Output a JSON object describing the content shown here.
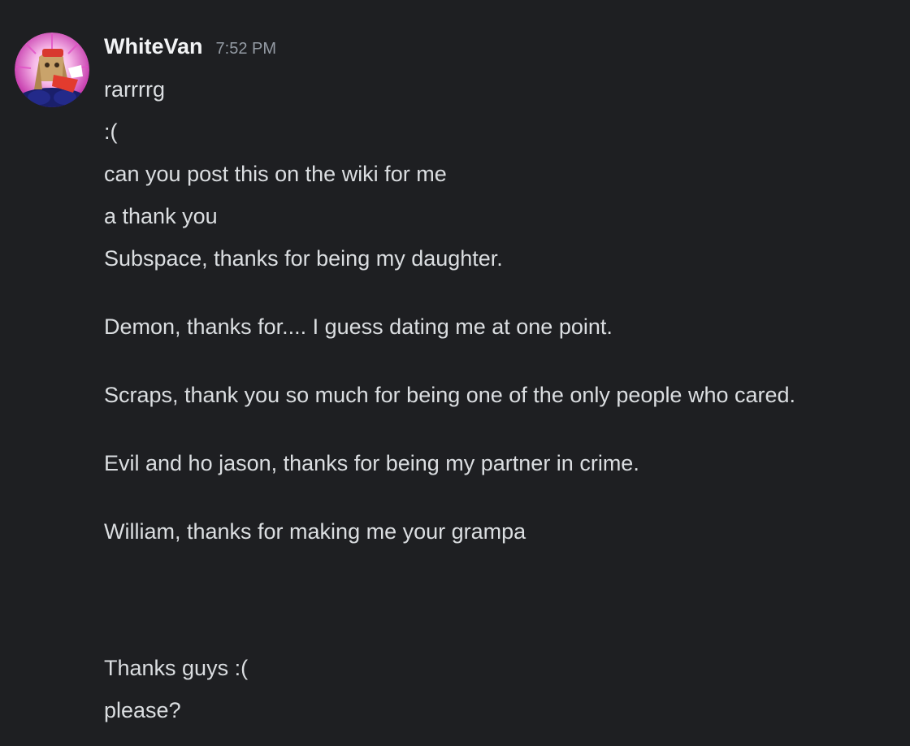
{
  "message": {
    "avatar_icon": "user-avatar",
    "username": "WhiteVan",
    "timestamp": "7:52 PM",
    "lines": [
      "rarrrrg",
      ":(",
      "can you post this on the wiki for me",
      "a thank you"
    ],
    "long_message": "Subspace, thanks for being my daughter.\n\nDemon, thanks for.... I guess dating me at one point.\n\nScraps, thank you so much for being one of the only people who cared.\n\nEvil and ho jason, thanks for being my partner in crime.\n\nWilliam, thanks for making me your grampa\n\n\n\nThanks guys :(",
    "last_line": "please?"
  },
  "colors": {
    "background": "#1e1f22",
    "text": "#dbdee1",
    "username": "#f2f3f5",
    "timestamp": "#949ba4"
  }
}
